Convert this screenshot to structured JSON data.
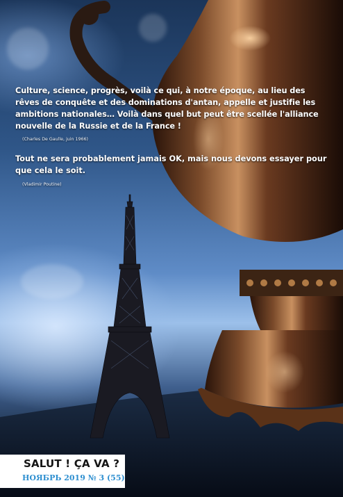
{
  "quotes": [
    {
      "text": "Culture, science, progrès, voilà ce qui, à notre époque, au lieu des rêves de conquête et des dominations d'antan, appelle et justifie les ambitions nationales… Voilà dans quel but peut être scellée l'alliance nouvelle de la Russie et de la France !",
      "author": "(Charles De Gaulle, juin 1966)"
    },
    {
      "text": "Tout ne sera probablement jamais OK, mais nous devons essayer pour que cela le soit.",
      "author": "(Vladimir Poutine)"
    }
  ],
  "masthead": {
    "title": "SALUT ! ÇA VA ?",
    "issue": "НОЯБРЬ 2019 № 3 (55)"
  },
  "colors": {
    "issue_blue": "#2e8fd0",
    "quote_text": "#ffffff"
  }
}
